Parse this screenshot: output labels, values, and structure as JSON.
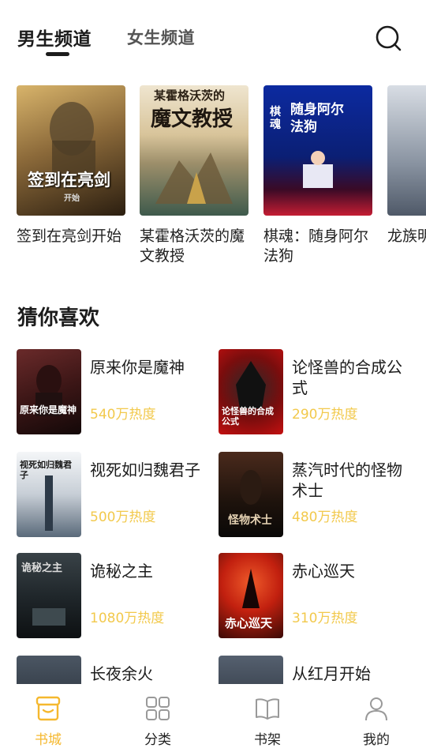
{
  "header": {
    "tabs": [
      {
        "label": "男生频道",
        "active": true
      },
      {
        "label": "女生频道",
        "active": false
      }
    ],
    "search_icon": "search-icon"
  },
  "featured": [
    {
      "title": "签到在亮剑开始",
      "cover_text": "签到在亮剑",
      "cover_sub": "开始",
      "colors": [
        "#c9a45c",
        "#3b2a17"
      ]
    },
    {
      "title": "某霍格沃茨的魔文教授",
      "cover_text": "魔文教授",
      "cover_top": "某霍格沃茨的",
      "colors": [
        "#d9c7a1",
        "#4d6a5c"
      ]
    },
    {
      "title": "棋魂：随身阿尔法狗",
      "cover_text": "随身阿尔法狗",
      "cover_top": "棋魂",
      "colors": [
        "#0b2a8f",
        "#c81c2c"
      ]
    },
    {
      "title": "龙族明非",
      "colors": [
        "#cfd5dd",
        "#6a7685"
      ]
    }
  ],
  "section": {
    "title": "猜你喜欢"
  },
  "recommendations": [
    {
      "title": "原来你是魔神",
      "heat": "540万热度",
      "cover_text": "原来你是魔神",
      "colors": [
        "#5a1e1e",
        "#1a0d0d"
      ]
    },
    {
      "title": "论怪兽的合成公式",
      "heat": "290万热度",
      "cover_text": "论怪兽的合成公式",
      "colors": [
        "#c41010",
        "#1a1a1a"
      ]
    },
    {
      "title": "视死如归魏君子",
      "heat": "500万热度",
      "cover_text": "视死如归魏君子",
      "colors": [
        "#e9ecef",
        "#3a4a5a"
      ]
    },
    {
      "title": "蒸汽时代的怪物术士",
      "heat": "480万热度",
      "cover_text": "怪物术士",
      "colors": [
        "#3a1f16",
        "#0d0b0a"
      ]
    },
    {
      "title": "诡秘之主",
      "heat": "1080万热度",
      "cover_text": "诡秘之主",
      "colors": [
        "#2d3337",
        "#0f1214"
      ]
    },
    {
      "title": "赤心巡天",
      "heat": "310万热度",
      "cover_text": "赤心巡天",
      "colors": [
        "#d83b1f",
        "#2a0a05"
      ]
    },
    {
      "title": "长夜余火",
      "heat": "",
      "cover_text": "",
      "colors": [
        "#3b4653",
        "#1a2028"
      ]
    },
    {
      "title": "从红月开始",
      "heat": "",
      "cover_text": "",
      "colors": [
        "#465060",
        "#1c222b"
      ]
    }
  ],
  "bottom_nav": [
    {
      "label": "书城",
      "icon": "store-icon",
      "active": true
    },
    {
      "label": "分类",
      "icon": "category-grid-icon",
      "active": false
    },
    {
      "label": "书架",
      "icon": "book-open-icon",
      "active": false
    },
    {
      "label": "我的",
      "icon": "user-icon",
      "active": false
    }
  ],
  "accent_color": "#f5b82e",
  "heat_color": "#f2c94c"
}
